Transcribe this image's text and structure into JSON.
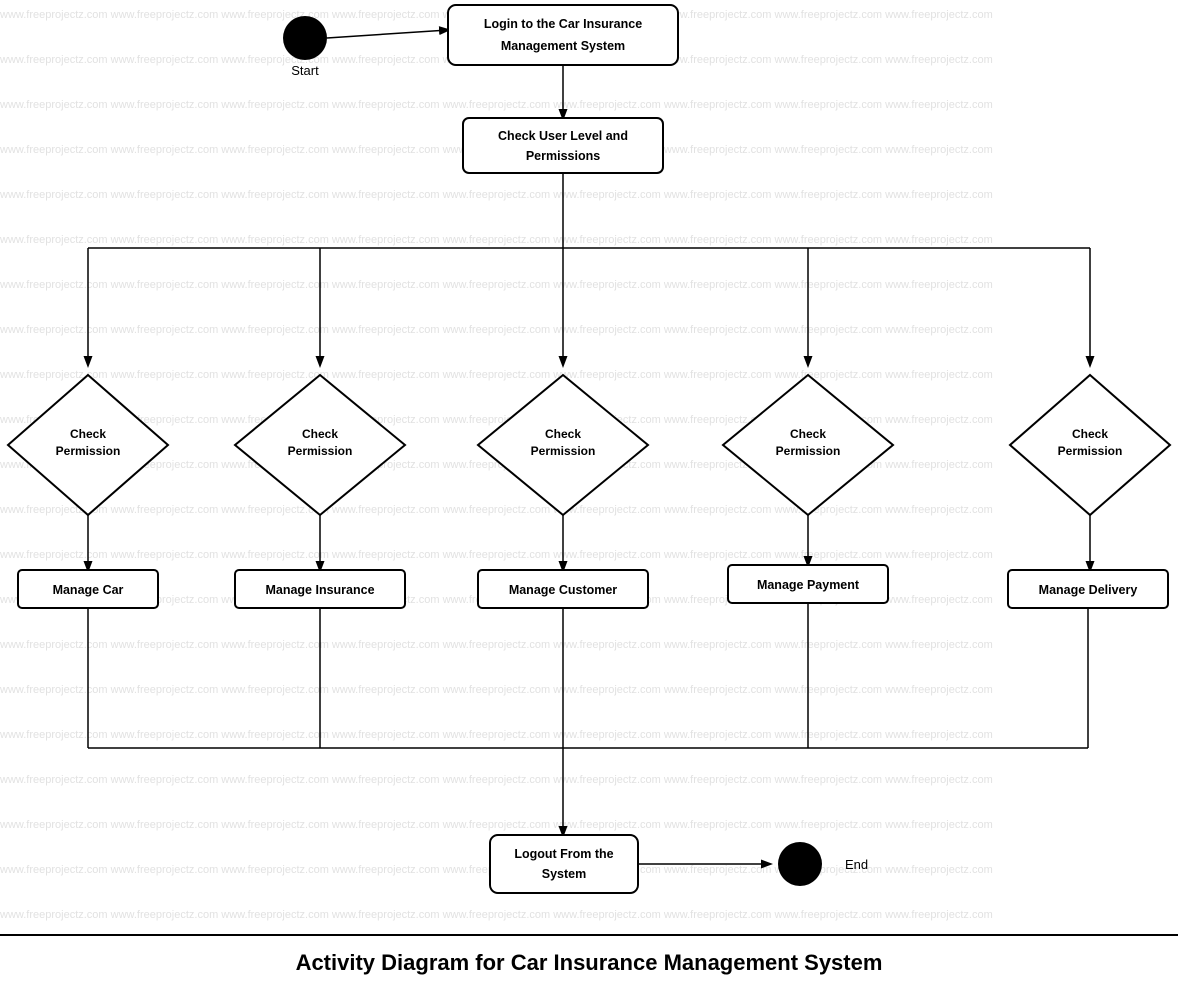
{
  "diagram": {
    "title": "Activity Diagram for Car Insurance Management System",
    "watermark": "www.freeprojectz.com",
    "nodes": {
      "login": "Login to the Car Insurance Management System",
      "checkUserLevel": "Check User Level and Permissions",
      "checkPermission1": "Check Permission",
      "checkPermission2": "Check Permission",
      "checkPermission3": "Check Permission",
      "checkPermission4": "Check Permission",
      "checkPermission5": "Check Permission",
      "manageCar": "Manage Car",
      "manageInsurance": "Manage Insurance",
      "manageCustomer": "Manage Customer",
      "managePayment": "Manage Payment",
      "manageDelivery": "Manage Delivery",
      "logout": "Logout From the System",
      "start": "Start",
      "end": "End"
    }
  }
}
